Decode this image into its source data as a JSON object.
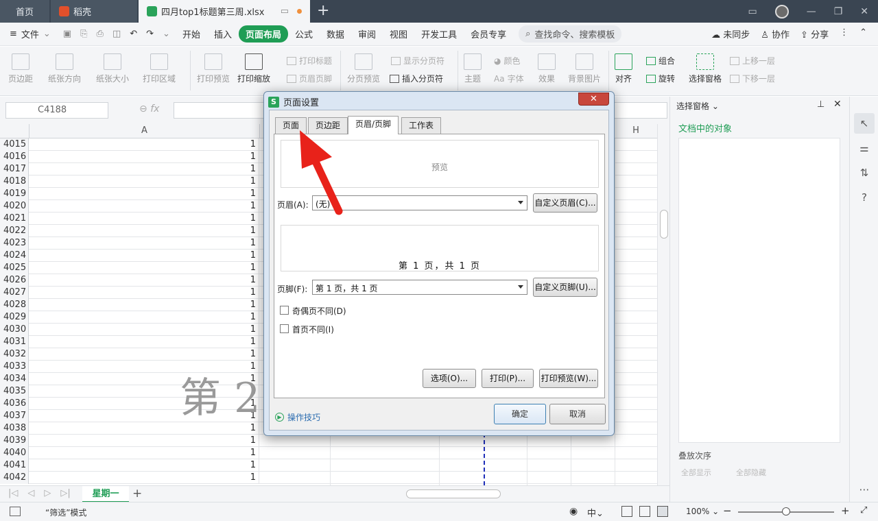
{
  "tabs": {
    "home": "首页",
    "daoke": "稻壳",
    "file": "四月top1标题第三周.xlsx"
  },
  "menu": {
    "file": "文件",
    "items": [
      "开始",
      "插入",
      "页面布局",
      "公式",
      "数据",
      "审阅",
      "视图",
      "开发工具",
      "会员专享"
    ],
    "active_index": 2,
    "search_placeholder": "查找命令、搜索模板",
    "sync": "未同步",
    "collab": "协作",
    "share": "分享"
  },
  "ribbon": {
    "margins": "页边距",
    "orientation": "纸张方向",
    "size": "纸张大小",
    "print_area": "打印区域",
    "print_preview": "打印预览",
    "print_scale": "打印缩放",
    "print_titles": "打印标题",
    "header_footer": "页眉页脚",
    "page_break_preview": "分页预览",
    "show_breaks": "显示分页符",
    "insert_break": "插入分页符",
    "theme": "主题",
    "colors": "颜色",
    "fonts": "字体",
    "effects": "效果",
    "bg_image": "背景图片",
    "align": "对齐",
    "group": "组合",
    "rotate": "旋转",
    "selection_pane": "选择窗格",
    "bring_forward": "上移一层",
    "send_backward": "下移一层"
  },
  "formula_bar": {
    "cell_ref": "C4188",
    "fx": "fx"
  },
  "grid": {
    "col_a": "A",
    "col_h": "H",
    "rows": [
      "4015",
      "4016",
      "4017",
      "4018",
      "4019",
      "4020",
      "4021",
      "4022",
      "4023",
      "4024",
      "4025",
      "4026",
      "4027",
      "4028",
      "4029",
      "4030",
      "4031",
      "4032",
      "4033",
      "4034",
      "4035",
      "4036",
      "4037",
      "4038",
      "4039",
      "4040",
      "4041",
      "4042"
    ],
    "value": "1",
    "watermark": "第 2"
  },
  "sheet": {
    "tab": "星期一"
  },
  "status": {
    "mode": "“筛选”模式",
    "zoom": "100%"
  },
  "right_pane": {
    "title": "选择窗格",
    "subtitle": "文档中的对象",
    "order": "叠放次序",
    "show_all": "全部显示",
    "hide_all": "全部隐藏"
  },
  "dialog": {
    "title": "页面设置",
    "tabs": [
      "页面",
      "页边距",
      "页眉/页脚",
      "工作表"
    ],
    "active_tab": 2,
    "preview_label": "预览",
    "header_label": "页眉(A):",
    "header_value": "(无)",
    "custom_header": "自定义页眉(C)...",
    "footer_preview": "第 1 页，共 1 页",
    "footer_label": "页脚(F):",
    "footer_value": "第 1 页，共 1 页",
    "custom_footer": "自定义页脚(U)...",
    "odd_even": "奇偶页不同(D)",
    "first_page": "首页不同(I)",
    "options": "选项(O)...",
    "print": "打印(P)...",
    "print_preview": "打印预览(W)...",
    "tips": "操作技巧",
    "ok": "确定",
    "cancel": "取消"
  },
  "colors": {
    "accent_green": "#1f9d55",
    "arrow_red": "#e8221a",
    "page_break_blue": "#1e2eb8"
  }
}
